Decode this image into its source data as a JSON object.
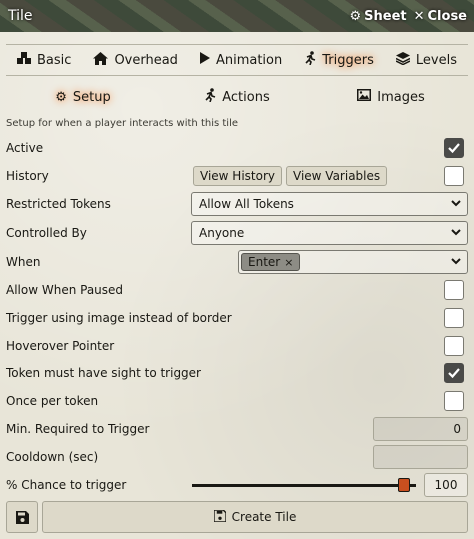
{
  "window": {
    "title": "Tile"
  },
  "header": {
    "sheet_label": "Sheet",
    "close_label": "Close"
  },
  "primary_tabs": [
    {
      "label": "Basic",
      "icon": "cubes-icon"
    },
    {
      "label": "Overhead",
      "icon": "home-icon"
    },
    {
      "label": "Animation",
      "icon": "play-icon"
    },
    {
      "label": "Triggers",
      "icon": "running-icon",
      "active": true
    },
    {
      "label": "Levels",
      "icon": "layer-group-icon"
    }
  ],
  "secondary_tabs": [
    {
      "label": "Setup",
      "icon": "cog-icon",
      "active": true
    },
    {
      "label": "Actions",
      "icon": "running-icon"
    },
    {
      "label": "Images",
      "icon": "image-icon"
    }
  ],
  "hint": "Setup for when a player interacts with this tile",
  "fields": {
    "active": {
      "label": "Active",
      "checked": true
    },
    "history": {
      "label": "History",
      "view_history": "View History",
      "view_variables": "View Variables",
      "checked": false
    },
    "restricted_tokens": {
      "label": "Restricted Tokens",
      "value": "Allow All Tokens"
    },
    "controlled_by": {
      "label": "Controlled By",
      "value": "Anyone"
    },
    "when": {
      "label": "When",
      "tag": "Enter",
      "tag_remove": "×"
    },
    "allow_when_paused": {
      "label": "Allow When Paused",
      "checked": false
    },
    "trigger_using_image": {
      "label": "Trigger using image instead of border",
      "checked": false
    },
    "hoverover_pointer": {
      "label": "Hoverover Pointer",
      "checked": false
    },
    "token_sight": {
      "label": "Token must have sight to trigger",
      "checked": true
    },
    "once_per_token": {
      "label": "Once per token",
      "checked": false
    },
    "min_required": {
      "label": "Min. Required to Trigger",
      "value": "0"
    },
    "cooldown": {
      "label": "Cooldown (sec)",
      "value": ""
    },
    "chance": {
      "label": "% Chance to trigger",
      "value": "100",
      "slider_fraction": 1.0
    }
  },
  "footer": {
    "create_label": "Create Tile"
  },
  "colors": {
    "accent": "#ff6400",
    "slider_thumb": "#c94f1f",
    "checked_bg": "#4a4a48"
  }
}
